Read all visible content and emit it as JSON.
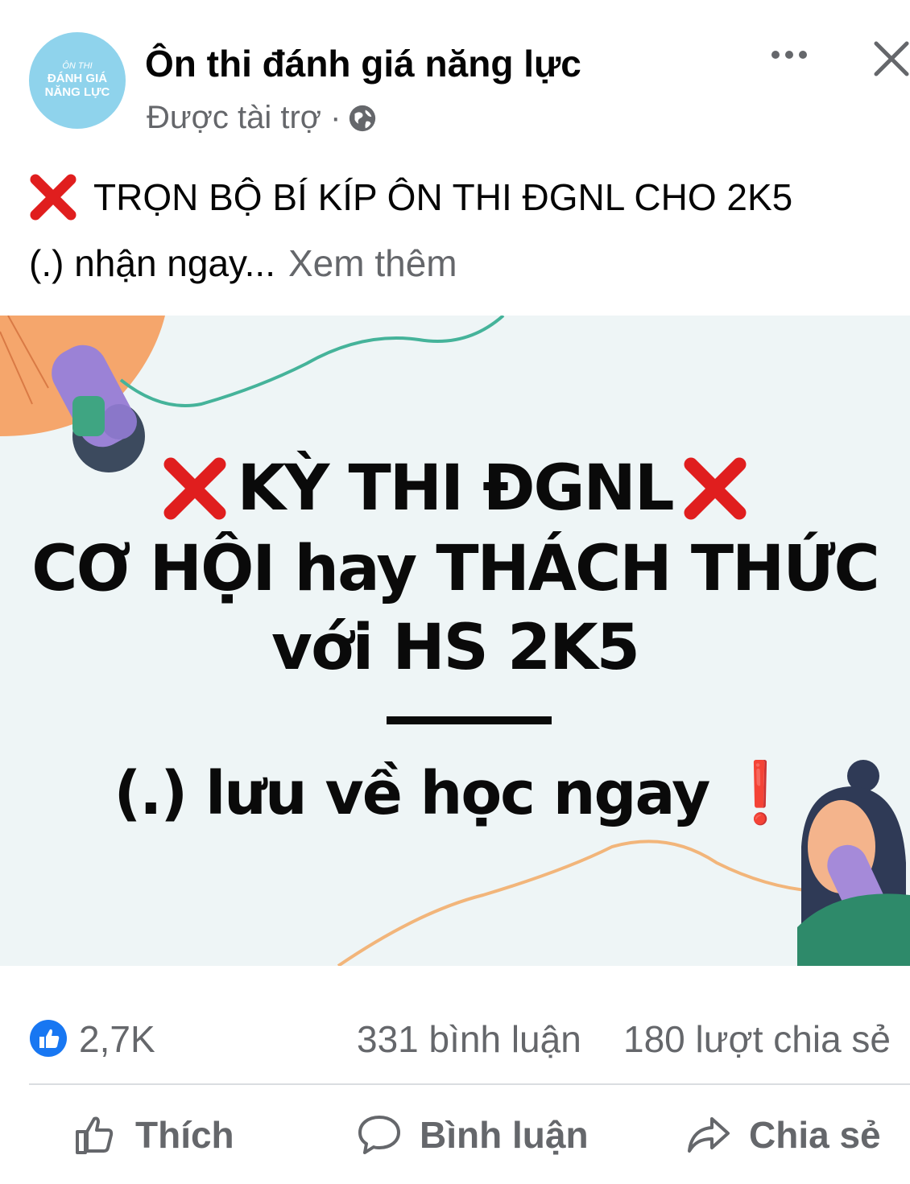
{
  "header": {
    "avatar_lines": [
      "ÔN THI",
      "ĐÁNH GIÁ",
      "NĂNG LỰC"
    ],
    "page_name": "Ôn thi đánh giá năng lực",
    "sponsored": "Được tài trợ ·",
    "icons": [
      "globe-icon",
      "more-icon",
      "close-icon"
    ]
  },
  "caption": {
    "line1": "TRỌN BỘ BÍ KÍP ÔN THI ĐGNL CHO 2K5",
    "line2": "(.) nhận ngay...",
    "see_more": "Xem thêm"
  },
  "image": {
    "line1": "KỲ THI ĐGNL",
    "line2": "CƠ HỘI hay THÁCH THỨC",
    "line3": "với HS 2K5",
    "line4": "(.) lưu về học ngay",
    "line4_mark": "❗",
    "colors": {
      "background": "#eef5f6",
      "x_mark": "#e01e1e",
      "text": "#0a0a0a"
    }
  },
  "stats": {
    "likes": "2,7K",
    "comments": "331 bình luận",
    "shares": "180 lượt chia sẻ"
  },
  "actions": {
    "like": "Thích",
    "comment": "Bình luận",
    "share": "Chia sẻ"
  },
  "colors": {
    "like_blue": "#1877f2",
    "secondary_text": "#65676b"
  }
}
